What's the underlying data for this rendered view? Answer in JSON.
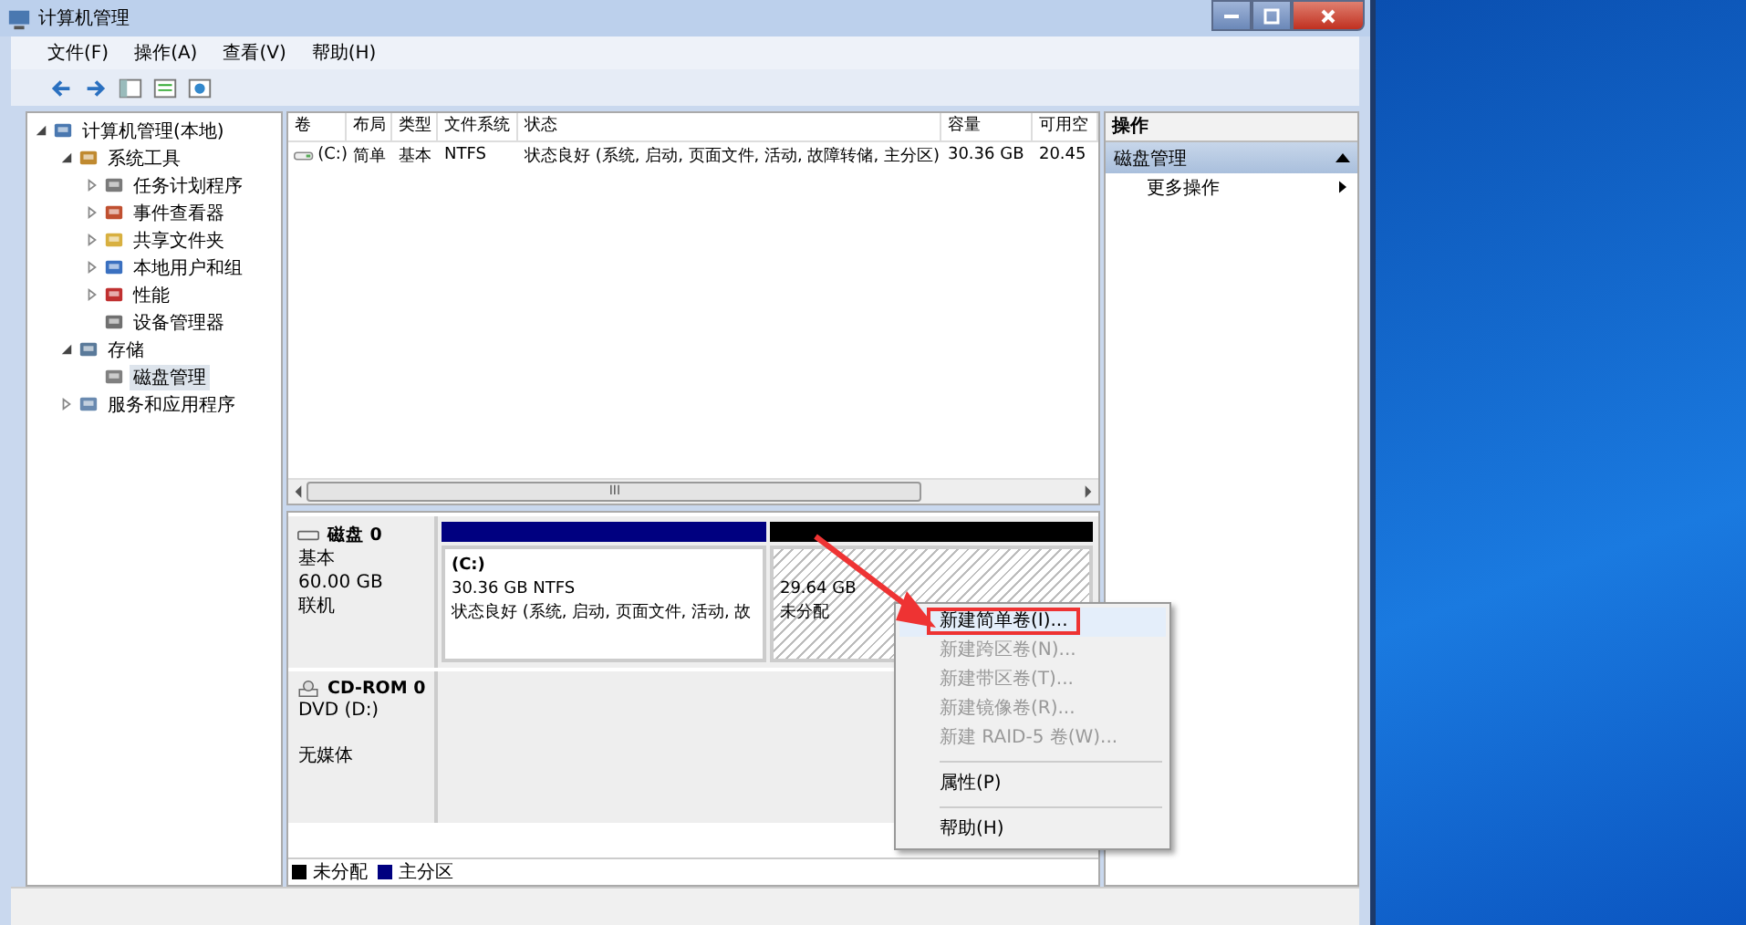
{
  "window": {
    "title": "计算机管理"
  },
  "menu": [
    "文件(F)",
    "操作(A)",
    "查看(V)",
    "帮助(H)"
  ],
  "tree": [
    {
      "label": "计算机管理(本地)",
      "expanded": true,
      "selected": false,
      "children": [
        {
          "label": "系统工具",
          "expanded": true,
          "selected": false,
          "children": [
            {
              "label": "任务计划程序",
              "expanded": false,
              "selected": false
            },
            {
              "label": "事件查看器",
              "expanded": false,
              "selected": false
            },
            {
              "label": "共享文件夹",
              "expanded": false,
              "selected": false
            },
            {
              "label": "本地用户和组",
              "expanded": false,
              "selected": false
            },
            {
              "label": "性能",
              "expanded": false,
              "selected": false
            },
            {
              "label": "设备管理器",
              "selected": false
            }
          ]
        },
        {
          "label": "存储",
          "expanded": true,
          "selected": false,
          "children": [
            {
              "label": "磁盘管理",
              "selected": true
            }
          ]
        },
        {
          "label": "服务和应用程序",
          "expanded": false,
          "selected": false
        }
      ]
    }
  ],
  "table": {
    "columns": [
      "卷",
      "布局",
      "类型",
      "文件系统",
      "状态",
      "容量",
      "可用空"
    ],
    "rows": [
      [
        "(C:)",
        "简单",
        "基本",
        "NTFS",
        "状态良好 (系统, 启动, 页面文件, 活动, 故障转储, 主分区)",
        "30.36 GB",
        "20.45"
      ]
    ]
  },
  "scroll_grip": "III",
  "disks": [
    {
      "kind": "disk",
      "name": "磁盘 0",
      "lines": [
        "基本",
        "60.00 GB",
        "联机"
      ],
      "partitions": [
        {
          "kind": "primary",
          "name": "(C:)",
          "lines": [
            "30.36 GB NTFS",
            "状态良好 (系统, 启动, 页面文件, 活动, 故"
          ]
        },
        {
          "kind": "unallocated",
          "lines": [
            "29.64 GB",
            "未分配"
          ]
        }
      ]
    },
    {
      "kind": "cdrom",
      "name": "CD-ROM 0",
      "lines": [
        "DVD (D:)",
        "无媒体"
      ]
    }
  ],
  "legend": [
    {
      "label": "未分配",
      "color": "#000000"
    },
    {
      "label": "主分区",
      "color": "#000080"
    }
  ],
  "actions": {
    "title": "操作",
    "section": "磁盘管理",
    "items": [
      "更多操作"
    ]
  },
  "context_menu": [
    {
      "label": "新建简单卷(I)...",
      "disabled": false,
      "selected": true
    },
    {
      "label": "新建跨区卷(N)...",
      "disabled": true,
      "selected": false
    },
    {
      "label": "新建带区卷(T)...",
      "disabled": true,
      "selected": false
    },
    {
      "label": "新建镜像卷(R)...",
      "disabled": true,
      "selected": false
    },
    {
      "label": "新建 RAID-5 卷(W)...",
      "disabled": true,
      "selected": false
    },
    {
      "label": "属性(P)",
      "disabled": false,
      "selected": false,
      "separator_before": true
    },
    {
      "label": "帮助(H)",
      "disabled": false,
      "selected": false,
      "separator_before": true
    }
  ]
}
